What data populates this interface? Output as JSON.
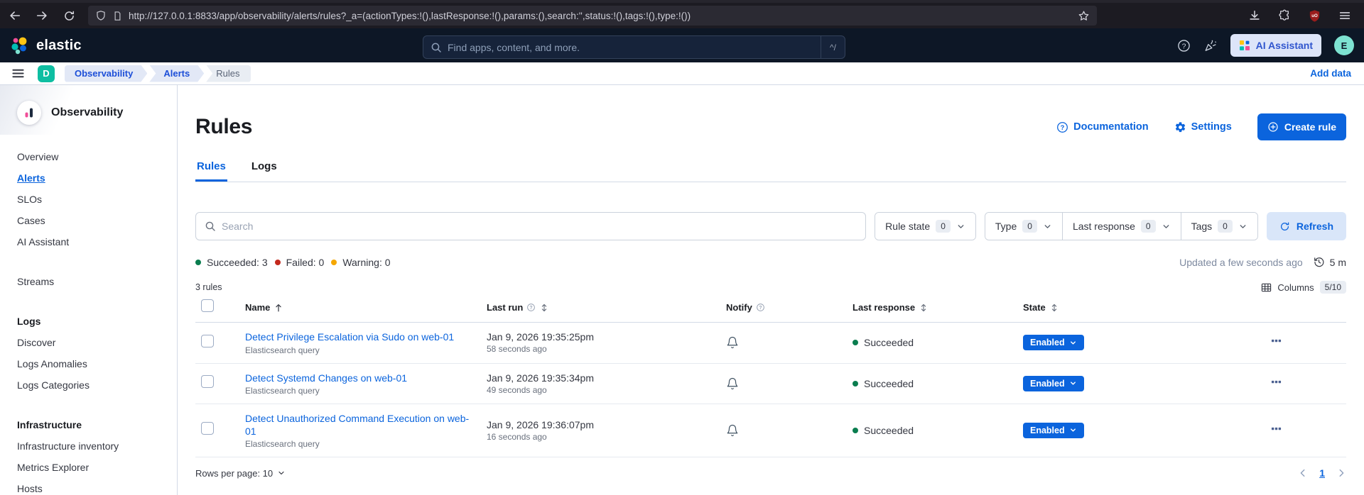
{
  "browser": {
    "url": "http://127.0.0.1:8833/app/observability/alerts/rules?_a=(actionTypes:!(),lastResponse:!(),params:(),search:'',status:!(),tags:!(),type:!())"
  },
  "header": {
    "logo_text": "elastic",
    "search_placeholder": "Find apps, content, and more.",
    "search_shortcut": "^/",
    "ai_assistant_label": "AI Assistant",
    "avatar_initial": "E"
  },
  "breadcrumb_bar": {
    "space_initial": "D",
    "crumbs": [
      "Observability",
      "Alerts",
      "Rules"
    ],
    "add_data_label": "Add data"
  },
  "sidebar": {
    "title": "Observability",
    "groups": [
      {
        "items": [
          "Overview",
          "Alerts",
          "SLOs",
          "Cases",
          "AI Assistant"
        ]
      },
      {
        "items": [
          "Streams"
        ]
      },
      {
        "header": "Logs",
        "items": [
          "Discover",
          "Logs Anomalies",
          "Logs Categories"
        ]
      },
      {
        "header": "Infrastructure",
        "items": [
          "Infrastructure inventory",
          "Metrics Explorer",
          "Hosts"
        ]
      }
    ],
    "active_item": "Alerts"
  },
  "page": {
    "title": "Rules",
    "documentation_label": "Documentation",
    "settings_label": "Settings",
    "create_rule_label": "Create rule",
    "tabs": {
      "rules": "Rules",
      "logs": "Logs"
    },
    "active_tab": "Rules"
  },
  "toolbar": {
    "search_placeholder": "Search",
    "filters": [
      {
        "label": "Rule state",
        "count": "0"
      },
      {
        "label": "Type",
        "count": "0"
      },
      {
        "label": "Last response",
        "count": "0"
      },
      {
        "label": "Tags",
        "count": "0"
      }
    ],
    "refresh_label": "Refresh"
  },
  "status_bar": {
    "succeeded": "Succeeded: 3",
    "failed": "Failed: 0",
    "warning": "Warning: 0",
    "updated": "Updated a few seconds ago",
    "interval": "5 m"
  },
  "table_meta": {
    "count_label": "3 rules",
    "columns_label": "Columns",
    "columns_count": "5/10"
  },
  "table": {
    "headers": {
      "name": "Name",
      "last_run": "Last run",
      "notify": "Notify",
      "last_response": "Last response",
      "state": "State"
    },
    "rows": [
      {
        "name": "Detect Privilege Escalation via Sudo on web-01",
        "type": "Elasticsearch query",
        "last_run": "Jan 9, 2026 19:35:25pm",
        "ago": "58 seconds ago",
        "response": "Succeeded",
        "state": "Enabled"
      },
      {
        "name": "Detect Systemd Changes on web-01",
        "type": "Elasticsearch query",
        "last_run": "Jan 9, 2026 19:35:34pm",
        "ago": "49 seconds ago",
        "response": "Succeeded",
        "state": "Enabled"
      },
      {
        "name": "Detect Unauthorized Command Execution on web-01",
        "type": "Elasticsearch query",
        "last_run": "Jan 9, 2026 19:36:07pm",
        "ago": "16 seconds ago",
        "response": "Succeeded",
        "state": "Enabled"
      }
    ]
  },
  "pagination": {
    "rows_per_page_label": "Rows per page: 10",
    "page": "1"
  },
  "colors": {
    "primary": "#0b64dd",
    "success": "#0a7d4f",
    "danger": "#c4291d",
    "warning": "#f5a700"
  }
}
